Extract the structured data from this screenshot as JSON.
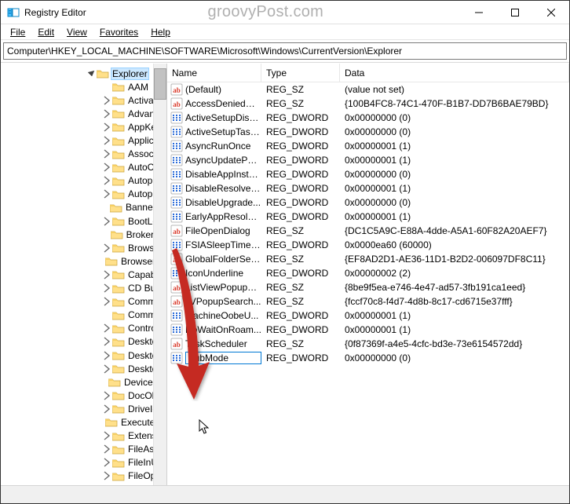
{
  "title": "Registry Editor",
  "watermark": "groovyPost.com",
  "menus": {
    "file": "File",
    "edit": "Edit",
    "view": "View",
    "favorites": "Favorites",
    "help": "Help"
  },
  "address": "Computer\\HKEY_LOCAL_MACHINE\\SOFTWARE\\Microsoft\\Windows\\CurrentVersion\\Explorer",
  "tree": {
    "indent_base": 106,
    "selected_index": 0,
    "items": [
      {
        "label": "Explorer",
        "expand": "open",
        "indent": 106,
        "selected": true
      },
      {
        "label": "AAM",
        "expand": "none",
        "indent": 126
      },
      {
        "label": "ActivateT",
        "expand": "closed",
        "indent": 126
      },
      {
        "label": "Advance",
        "expand": "closed",
        "indent": 126
      },
      {
        "label": "AppKey",
        "expand": "closed",
        "indent": 126
      },
      {
        "label": "Applicati",
        "expand": "closed",
        "indent": 126
      },
      {
        "label": "Associati",
        "expand": "closed",
        "indent": 126
      },
      {
        "label": "AutoCom",
        "expand": "closed",
        "indent": 126
      },
      {
        "label": "Autoplay",
        "expand": "closed",
        "indent": 126
      },
      {
        "label": "Autoplay",
        "expand": "closed",
        "indent": 126
      },
      {
        "label": "BannerSt",
        "expand": "none",
        "indent": 126
      },
      {
        "label": "BootLoca",
        "expand": "closed",
        "indent": 126
      },
      {
        "label": "BrokerEx",
        "expand": "none",
        "indent": 126
      },
      {
        "label": "BrowseN",
        "expand": "closed",
        "indent": 126
      },
      {
        "label": "Browser H",
        "expand": "none",
        "indent": 126
      },
      {
        "label": "Capabilit",
        "expand": "closed",
        "indent": 126
      },
      {
        "label": "CD Burni",
        "expand": "closed",
        "indent": 126
      },
      {
        "label": "Comman",
        "expand": "closed",
        "indent": 126
      },
      {
        "label": "Commor",
        "expand": "none",
        "indent": 126
      },
      {
        "label": "ControlP",
        "expand": "closed",
        "indent": 126
      },
      {
        "label": "Desktop",
        "expand": "closed",
        "indent": 126
      },
      {
        "label": "DesktopI",
        "expand": "closed",
        "indent": 126
      },
      {
        "label": "Desktop(",
        "expand": "closed",
        "indent": 126
      },
      {
        "label": "DeviceUp",
        "expand": "none",
        "indent": 126
      },
      {
        "label": "DocObjec",
        "expand": "closed",
        "indent": 126
      },
      {
        "label": "DriveIcor",
        "expand": "closed",
        "indent": 126
      },
      {
        "label": "ExecuteTy",
        "expand": "none",
        "indent": 126
      },
      {
        "label": "Extension",
        "expand": "closed",
        "indent": 126
      },
      {
        "label": "FileAssoc",
        "expand": "closed",
        "indent": 126
      },
      {
        "label": "FileInUse",
        "expand": "closed",
        "indent": 126
      },
      {
        "label": "FileOpera",
        "expand": "closed",
        "indent": 126
      }
    ]
  },
  "columns": {
    "name": "Name",
    "type": "Type",
    "data": "Data"
  },
  "values": [
    {
      "icon": "sz",
      "name": "(Default)",
      "type": "REG_SZ",
      "data": "(value not set)"
    },
    {
      "icon": "sz",
      "name": "AccessDeniedDi...",
      "type": "REG_SZ",
      "data": "{100B4FC8-74C1-470F-B1B7-DD7B6BAE79BD}"
    },
    {
      "icon": "dw",
      "name": "ActiveSetupDisa...",
      "type": "REG_DWORD",
      "data": "0x00000000 (0)"
    },
    {
      "icon": "dw",
      "name": "ActiveSetupTask...",
      "type": "REG_DWORD",
      "data": "0x00000000 (0)"
    },
    {
      "icon": "dw",
      "name": "AsyncRunOnce",
      "type": "REG_DWORD",
      "data": "0x00000001 (1)"
    },
    {
      "icon": "dw",
      "name": "AsyncUpdatePC...",
      "type": "REG_DWORD",
      "data": "0x00000001 (1)"
    },
    {
      "icon": "dw",
      "name": "DisableAppInsta...",
      "type": "REG_DWORD",
      "data": "0x00000000 (0)"
    },
    {
      "icon": "dw",
      "name": "DisableResolveS...",
      "type": "REG_DWORD",
      "data": "0x00000001 (1)"
    },
    {
      "icon": "dw",
      "name": "DisableUpgrade...",
      "type": "REG_DWORD",
      "data": "0x00000000 (0)"
    },
    {
      "icon": "dw",
      "name": "EarlyAppResolve...",
      "type": "REG_DWORD",
      "data": "0x00000001 (1)"
    },
    {
      "icon": "sz",
      "name": "FileOpenDialog",
      "type": "REG_SZ",
      "data": "{DC1C5A9C-E88A-4dde-A5A1-60F82A20AEF7}"
    },
    {
      "icon": "dw",
      "name": "FSIASleepTimeIn...",
      "type": "REG_DWORD",
      "data": "0x0000ea60 (60000)"
    },
    {
      "icon": "sz",
      "name": "GlobalFolderSett...",
      "type": "REG_SZ",
      "data": "{EF8AD2D1-AE36-11D1-B2D2-006097DF8C11}"
    },
    {
      "icon": "dw",
      "name": "IconUnderline",
      "type": "REG_DWORD",
      "data": "0x00000002 (2)"
    },
    {
      "icon": "sz",
      "name": "ListViewPopupC...",
      "type": "REG_SZ",
      "data": "{8be9f5ea-e746-4e47-ad57-3fb191ca1eed}"
    },
    {
      "icon": "sz",
      "name": "LVPopupSearch...",
      "type": "REG_SZ",
      "data": "{fccf70c8-f4d7-4d8b-8c17-cd6715e37fff}"
    },
    {
      "icon": "dw",
      "name": "MachineOobeU...",
      "type": "REG_DWORD",
      "data": "0x00000001 (1)"
    },
    {
      "icon": "dw",
      "name": "NoWaitOnRoam...",
      "type": "REG_DWORD",
      "data": "0x00000001 (1)"
    },
    {
      "icon": "sz",
      "name": "TaskScheduler",
      "type": "REG_SZ",
      "data": "{0f87369f-a4e5-4cfc-bd3e-73e6154572dd}"
    },
    {
      "icon": "dw",
      "name": "HubMode",
      "type": "REG_DWORD",
      "data": "0x00000000 (0)",
      "editing": true
    }
  ]
}
